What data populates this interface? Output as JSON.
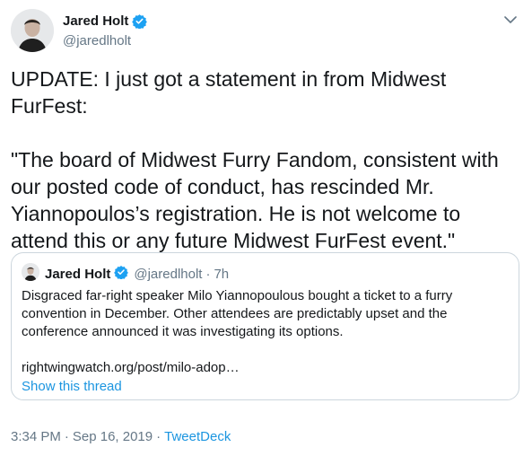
{
  "author": {
    "name": "Jared Holt",
    "handle": "@jaredlholt",
    "avatar_icon": "person-photo-icon",
    "verified_icon": "verified-badge-icon"
  },
  "tweet": {
    "text": "UPDATE: I just got a statement in from Midwest FurFest:\n\n\"The board of Midwest Furry Fandom, consistent with our posted code of conduct, has rescinded Mr. Yiannopoulos’s registration. He is not welcome to attend this or any future Midwest FurFest event.\""
  },
  "quote": {
    "name": "Jared Holt",
    "handle": "@jaredlholt",
    "separator": "·",
    "time": "7h",
    "text": "Disgraced far-right speaker Milo Yiannopoulous bought a ticket to a furry convention in December. Other attendees are predictably upset and the conference announced it was investigating its options.",
    "link": "rightwingwatch.org/post/milo-adop…",
    "thread_label": "Show this thread"
  },
  "meta": {
    "time": "3:34 PM",
    "separator1": "·",
    "date": "Sep 16, 2019",
    "separator2": "·",
    "source": "TweetDeck"
  },
  "colors": {
    "accent": "#1b95e0",
    "text": "#14171a",
    "muted": "#657786",
    "border": "#ccd6dd"
  }
}
